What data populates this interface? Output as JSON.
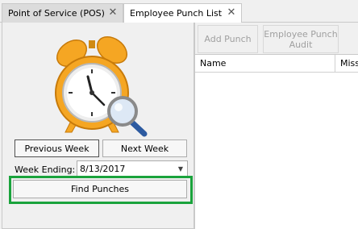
{
  "tabs": [
    {
      "label": "Point of Service (POS)",
      "close": "✕"
    },
    {
      "label": "Employee Punch List",
      "close": "✕"
    }
  ],
  "left": {
    "previous_week_label": "Previous Week",
    "next_week_label": "Next Week",
    "week_ending_label": "Week Ending:",
    "week_ending_value": "8/13/2017",
    "dropdown_glyph": "▼",
    "find_punches_label": "Find Punches",
    "illustration_icon": "alarm-clock-magnifier-icon"
  },
  "toolbar": {
    "add_punch_label": "Add Punch",
    "audit_label_line1": "Employee Punch",
    "audit_label_line2": "Audit"
  },
  "grid": {
    "columns": [
      "Name",
      "Miss"
    ]
  },
  "colors": {
    "highlight_outline": "#1aa33c",
    "clock_orange": "#f5a623",
    "disabled_text": "#a0a0a0"
  }
}
